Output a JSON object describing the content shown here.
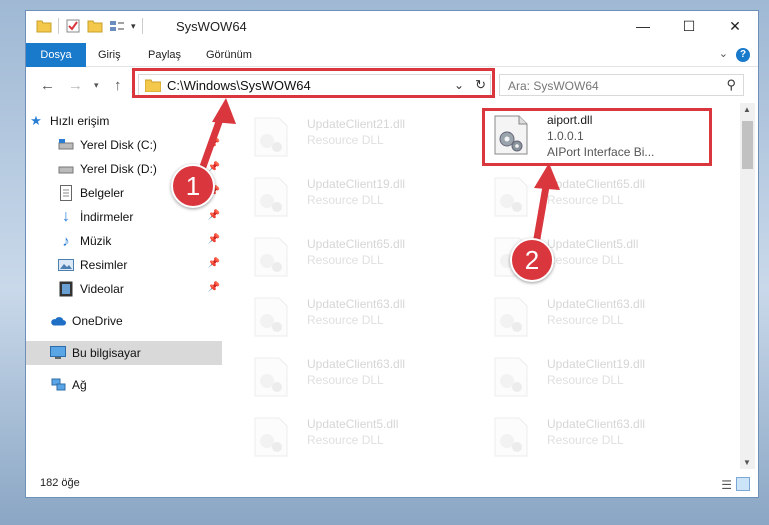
{
  "window": {
    "title": "SysWOW64",
    "controls": {
      "minimize": "—",
      "maximize": "☐",
      "close": "✕"
    }
  },
  "ribbon": {
    "tabs": [
      "Dosya",
      "Giriş",
      "Paylaş",
      "Görünüm"
    ],
    "help": "?"
  },
  "address": {
    "path": "C:\\Windows\\SysWOW64",
    "search_placeholder": "Ara: SysWOW64"
  },
  "nav": {
    "items": [
      {
        "label": "Hızlı erişim",
        "icon": "star-icon",
        "pinned": false
      },
      {
        "label": "Yerel Disk (C:)",
        "icon": "drive-icon",
        "pinned": true
      },
      {
        "label": "Yerel Disk (D:)",
        "icon": "drive-icon",
        "pinned": true
      },
      {
        "label": "Belgeler",
        "icon": "document-icon",
        "pinned": true
      },
      {
        "label": "İndirmeler",
        "icon": "download-icon",
        "pinned": true
      },
      {
        "label": "Müzik",
        "icon": "music-icon",
        "pinned": true
      },
      {
        "label": "Resimler",
        "icon": "pictures-icon",
        "pinned": true
      },
      {
        "label": "Videolar",
        "icon": "video-icon",
        "pinned": true
      },
      {
        "label": "OneDrive",
        "icon": "cloud-icon",
        "pinned": false
      },
      {
        "label": "Bu bilgisayar",
        "icon": "computer-icon",
        "pinned": false,
        "selected": true
      },
      {
        "label": "Ağ",
        "icon": "network-icon",
        "pinned": false
      }
    ]
  },
  "files": [
    {
      "name": "UpdateClient21.dll",
      "desc": "Resource DLL"
    },
    {
      "name": "aiport.dll",
      "version": "1.0.0.1",
      "desc": "AIPort Interface Bi...",
      "highlighted": true
    },
    {
      "name": "UpdateClient19.dll",
      "desc": "Resource DLL"
    },
    {
      "name": "UpdateClient65.dll",
      "desc": "Resource DLL"
    },
    {
      "name": "UpdateClient65.dll",
      "desc": "Resource DLL"
    },
    {
      "name": "UpdateClient5.dll",
      "desc": "Resource DLL"
    },
    {
      "name": "UpdateClient63.dll",
      "desc": "Resource DLL"
    },
    {
      "name": "UpdateClient63.dll",
      "desc": "Resource DLL"
    },
    {
      "name": "UpdateClient63.dll",
      "desc": "Resource DLL"
    },
    {
      "name": "UpdateClient19.dll",
      "desc": "Resource DLL"
    },
    {
      "name": "UpdateClient5.dll",
      "desc": "Resource DLL"
    },
    {
      "name": "UpdateClient63.dll",
      "desc": "Resource DLL"
    }
  ],
  "status": {
    "count": "182 öğe"
  },
  "annotations": {
    "step1": "1",
    "step2": "2",
    "color": "#d9363e"
  }
}
